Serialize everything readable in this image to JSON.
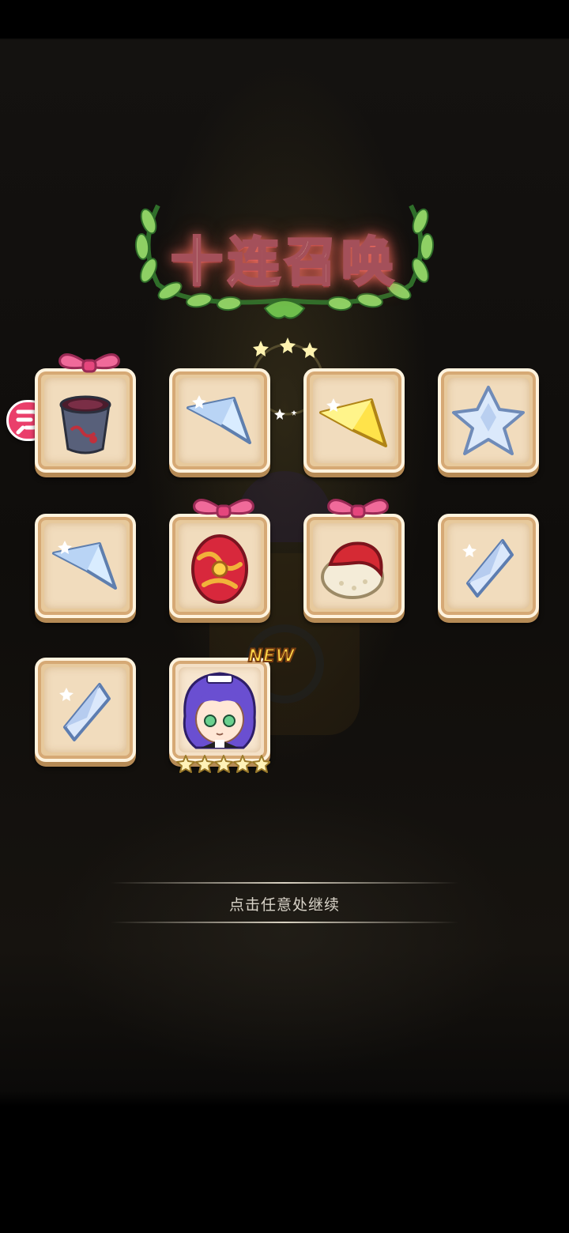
{
  "title": "十连召唤",
  "continue_prompt": "点击任意处继续",
  "new_badge": "NEW",
  "summon_results": [
    {
      "item": "dark-potion-cup",
      "gift_bow": true
    },
    {
      "item": "silver-star-shard",
      "gift_bow": false
    },
    {
      "item": "gold-star-shard",
      "gift_bow": false
    },
    {
      "item": "silver-crystal-cluster",
      "gift_bow": false
    },
    {
      "item": "silver-star-shard",
      "gift_bow": false
    },
    {
      "item": "red-gold-egg",
      "gift_bow": true
    },
    {
      "item": "red-rice-ball",
      "gift_bow": true
    },
    {
      "item": "blue-diamond-shard",
      "gift_bow": false
    },
    {
      "item": "blue-diamond-shard",
      "gift_bow": false
    },
    {
      "item": "purple-hair-maid-character",
      "gift_bow": false,
      "is_new": true,
      "rarity_stars": 5
    }
  ],
  "side_button_icon": "share-arrow-icon",
  "colors": {
    "title_glow": "#ff7a6a",
    "card_frame": "#e7c99c",
    "bow": "#f06a9a",
    "side_button": "#ea3f6b"
  }
}
